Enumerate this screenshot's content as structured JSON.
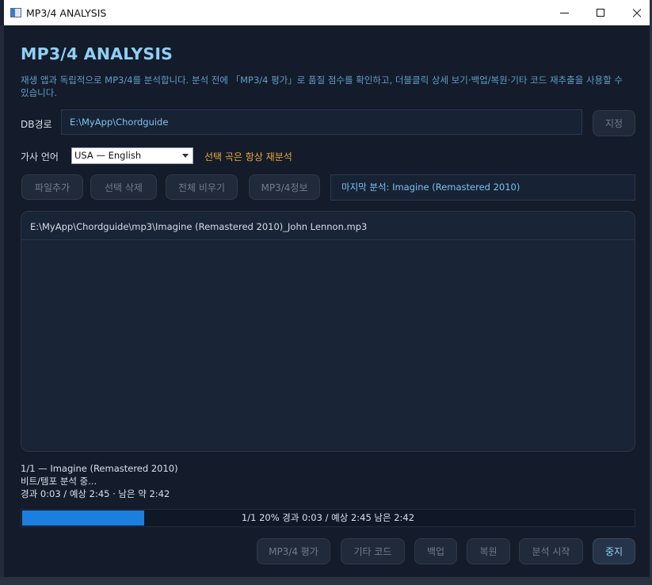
{
  "window": {
    "title": "MP3/4 ANALYSIS"
  },
  "main": {
    "heading": "MP3/4 ANALYSIS",
    "description": "재생 앱과 독립적으로 MP3/4를 분석합니다. 분석 전에 「MP3/4 평가」로 품질 점수를 확인하고, 더블클릭 상세 보기·백업/복원·기타 코드 재추출을 사용할 수 있습니다.",
    "db_label": "DB경로",
    "db_path": "E:\\MyApp\\Chordguide",
    "set_button": "지정",
    "lyrics_lang_label": "가사 언어",
    "lyrics_lang_value": "USA — English",
    "reanalyze_note": "선택 곡은 항상 재분석",
    "file_buttons": [
      "파일추가",
      "선택 삭제",
      "전체 비우기",
      "MP3/4정보"
    ],
    "last_analysis": "마지막 분석: Imagine (Remastered 2010)",
    "files": [
      "E:\\MyApp\\Chordguide\\mp3\\Imagine (Remastered 2010)_John Lennon.mp3"
    ]
  },
  "status": {
    "track": "1/1 — Imagine (Remastered 2010)",
    "stage": "비트/템포 분석 중...",
    "time": "경과 0:03 / 예상 2:45 · 남은 약 2:42"
  },
  "progress": {
    "percent": 20,
    "text": "1/1  20%  경과 0:03 / 예상 2:45  남은 2:42"
  },
  "bottom_buttons": [
    "MP3/4 평가",
    "기타 코드",
    "백업",
    "복원",
    "분석 시작",
    "중지"
  ]
}
